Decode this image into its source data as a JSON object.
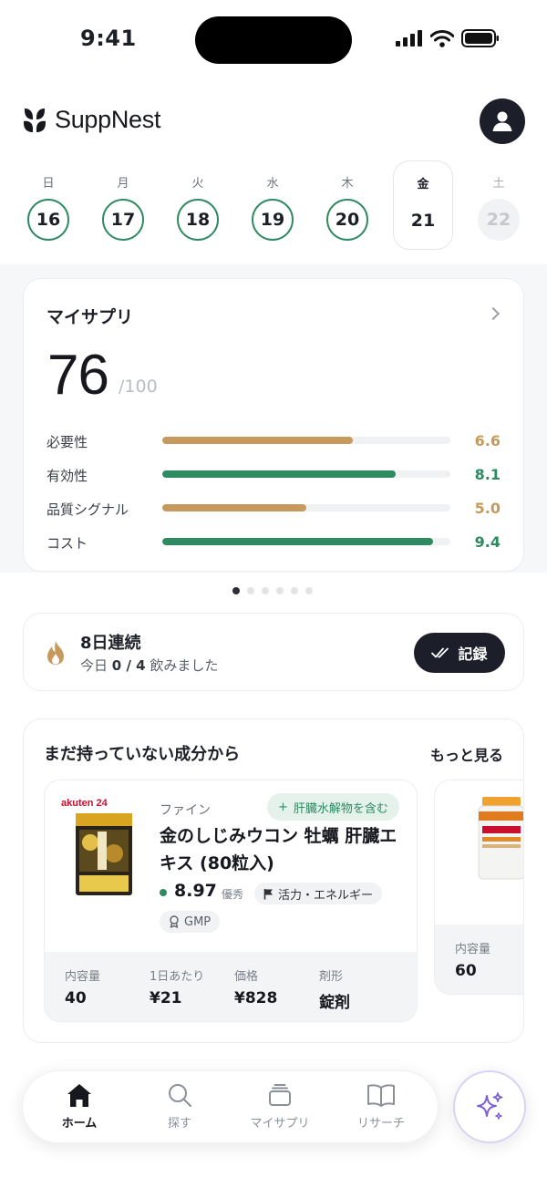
{
  "status_bar": {
    "time": "9:41"
  },
  "header": {
    "logo_text": "SuppNest",
    "logo_icon": "leaf-logo-icon",
    "avatar_icon": "user-icon"
  },
  "week": [
    {
      "name": "日",
      "date": "16",
      "state": "done"
    },
    {
      "name": "月",
      "date": "17",
      "state": "done"
    },
    {
      "name": "火",
      "date": "18",
      "state": "done"
    },
    {
      "name": "水",
      "date": "19",
      "state": "done"
    },
    {
      "name": "木",
      "date": "20",
      "state": "done"
    },
    {
      "name": "金",
      "date": "21",
      "state": "today"
    },
    {
      "name": "土",
      "date": "22",
      "state": "future"
    }
  ],
  "my_supp": {
    "title": "マイサプリ",
    "score": "76",
    "score_max": "/100",
    "metrics": [
      {
        "label": "必要性",
        "value": "6.6",
        "color": "#c69a5c"
      },
      {
        "label": "有効性",
        "value": "8.1",
        "color": "#2f8a62"
      },
      {
        "label": "品質シグナル",
        "value": "5.0",
        "color": "#c69a5c"
      },
      {
        "label": "コスト",
        "value": "9.4",
        "color": "#2f8a62"
      }
    ],
    "metric_max": 10
  },
  "pager": {
    "count": 6,
    "active": 0
  },
  "streak": {
    "title": "8日連続",
    "sub_prefix": "今日 ",
    "sub_count": "0 / 4",
    "sub_suffix": " 飲みました",
    "record_label": "記録",
    "icon": "flame-icon"
  },
  "recommend": {
    "title": "まだ持っていない成分から",
    "more": "もっと見る",
    "product": {
      "brand": "ファイン",
      "tag": "肝臓水解物を含む",
      "name": "金のしじみウコン 牡蠣 肝臓エキス (80粒入)",
      "score": "8.97",
      "score_label": "優秀",
      "category": "活力・エネルギー",
      "cert": "GMP",
      "specs": [
        {
          "k": "内容量",
          "v": "40"
        },
        {
          "k": "1日あたり",
          "v": "¥21"
        },
        {
          "k": "価格",
          "v": "¥828"
        },
        {
          "k": "剤形",
          "v": "錠剤"
        }
      ]
    },
    "product2": {
      "spec_k": "内容量",
      "spec_v": "60"
    }
  },
  "nav": [
    {
      "label": "ホーム",
      "icon": "home-icon",
      "active": true
    },
    {
      "label": "探す",
      "icon": "search-icon",
      "active": false
    },
    {
      "label": "マイサプリ",
      "icon": "stack-icon",
      "active": false
    },
    {
      "label": "リサーチ",
      "icon": "book-icon",
      "active": false
    }
  ],
  "fab_icon": "sparkle-icon"
}
